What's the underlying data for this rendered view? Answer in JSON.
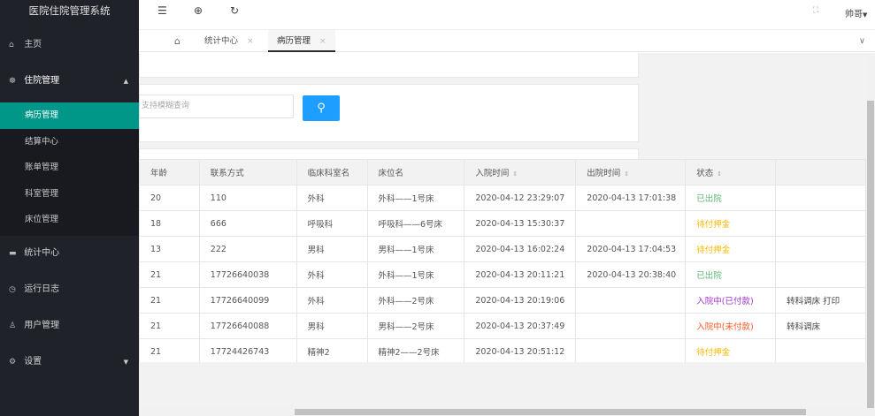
{
  "app": {
    "title": "医院住院管理系统",
    "user": "帅哥"
  },
  "topbar": {
    "fold_icon": "☰",
    "globe_icon": "⊕",
    "refresh_icon": "↻",
    "fullscreen_icon": "⛶"
  },
  "sidebar": {
    "items": [
      {
        "label": "主页",
        "icon": "⌂"
      },
      {
        "label": "住院管理",
        "icon": "☸"
      },
      {
        "label": "统计中心",
        "icon": "▬"
      },
      {
        "label": "运行日志",
        "icon": "◷"
      },
      {
        "label": "用户管理",
        "icon": "♙"
      },
      {
        "label": "设置",
        "icon": "⚙"
      }
    ],
    "submenu": [
      "病历管理",
      "结算中心",
      "账单管理",
      "科室管理",
      "床位管理"
    ]
  },
  "tabs": [
    {
      "label": "统计中心"
    },
    {
      "label": "病历管理"
    }
  ],
  "search": {
    "placeholder": "支持模糊查询"
  },
  "table": {
    "headers": [
      "年龄",
      "联系方式",
      "临床科室名",
      "床位名",
      "入院时间",
      "出院时间",
      "状态",
      ""
    ],
    "rows": [
      [
        "20",
        "110",
        "外科",
        "外科——1号床",
        "2020-04-12 23:29:07",
        "2020-04-13 17:01:38",
        "已出院",
        ""
      ],
      [
        "18",
        "666",
        "呼吸科",
        "呼吸科——6号床",
        "2020-04-13 15:30:37",
        "",
        "待付押金",
        ""
      ],
      [
        "13",
        "222",
        "男科",
        "男科——1号床",
        "2020-04-13 16:02:24",
        "2020-04-13 17:04:53",
        "待付押金",
        ""
      ],
      [
        "21",
        "17726640038",
        "外科",
        "外科——1号床",
        "2020-04-13 20:11:21",
        "2020-04-13 20:38:40",
        "已出院",
        ""
      ],
      [
        "21",
        "17726640099",
        "外科",
        "外科——2号床",
        "2020-04-13 20:19:06",
        "",
        "入院中(已付款)",
        "转科调床 打印"
      ],
      [
        "21",
        "17726640088",
        "男科",
        "男科——2号床",
        "2020-04-13 20:37:49",
        "",
        "入院中(未付款)",
        "转科调床"
      ],
      [
        "21",
        "17724426743",
        "精神2",
        "精神2——2号床",
        "2020-04-13 20:51:12",
        "",
        "待付押金",
        ""
      ]
    ]
  },
  "colors": {
    "status_discharged": "#5fb878",
    "status_deposit": "#ffb800",
    "status_paid": "#a233c6",
    "status_unpaid": "#ff5722",
    "accent": "#009688",
    "search_button": "#1e9fff"
  }
}
